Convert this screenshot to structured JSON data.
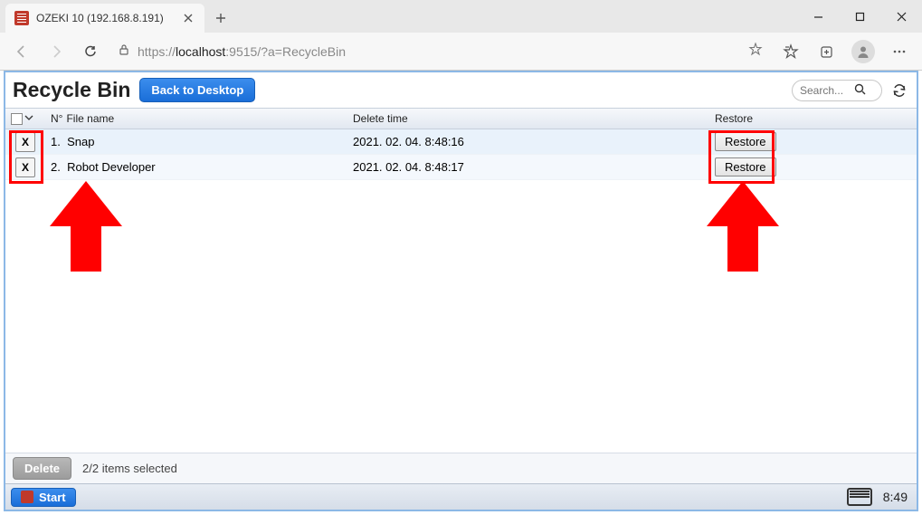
{
  "browser": {
    "tab_title": "OZEKI 10 (192.168.8.191)",
    "url_host": "localhost",
    "url_prefix": "https://",
    "url_port_path": ":9515/?a=RecycleBin"
  },
  "page": {
    "title": "Recycle Bin",
    "back_button": "Back to Desktop",
    "search_placeholder": "Search...",
    "columns": {
      "n": "N°",
      "filename": "File name",
      "delete_time": "Delete time",
      "restore": "Restore"
    },
    "rows": [
      {
        "x": "X",
        "n": "1.",
        "name": "Snap",
        "time": "2021. 02. 04. 8:48:16",
        "restore": "Restore"
      },
      {
        "x": "X",
        "n": "2.",
        "name": "Robot Developer",
        "time": "2021. 02. 04. 8:48:17",
        "restore": "Restore"
      }
    ],
    "delete_button": "Delete",
    "selection_status": "2/2 items selected"
  },
  "taskbar": {
    "start": "Start",
    "clock": "8:49"
  }
}
